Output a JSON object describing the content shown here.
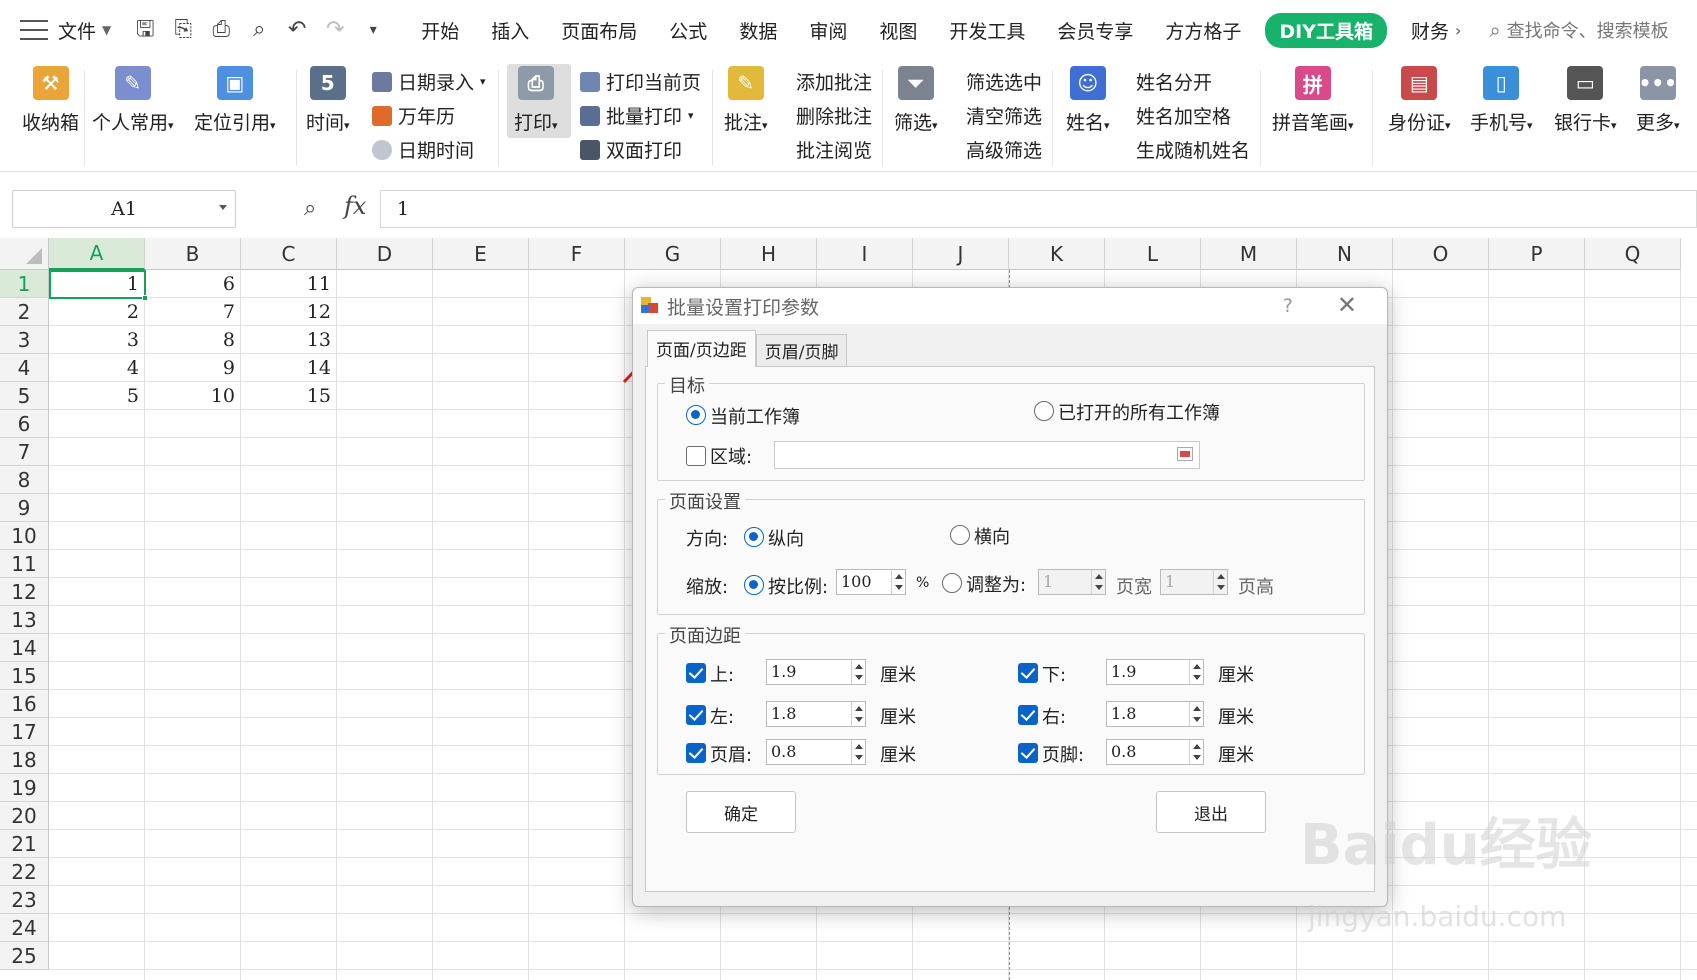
{
  "menubar": {
    "file_label": "文件",
    "tabs": [
      "开始",
      "插入",
      "页面布局",
      "公式",
      "数据",
      "审阅",
      "视图",
      "开发工具",
      "会员专享",
      "方方格子",
      "DIY工具箱",
      "财务"
    ],
    "search_placeholder": "查找命令、搜索模板"
  },
  "ribbon": {
    "toolbox": "收纳箱",
    "personal": "个人常用",
    "locate_ref": "定位引用",
    "time": "时间",
    "date_entry": "日期录入",
    "calendar": "万年历",
    "date_time": "日期时间",
    "print": "打印",
    "print_current": "打印当前页",
    "batch_print": "批量打印",
    "duplex_print": "双面打印",
    "comment": "批注",
    "add_comment": "添加批注",
    "delete_comment": "删除批注",
    "review_comment": "批注阅览",
    "filter": "筛选",
    "filter_selected": "筛选选中",
    "clear_filter": "清空筛选",
    "advanced_filter": "高级筛选",
    "name": "姓名",
    "split_name": "姓名分开",
    "name_spacing": "姓名加空格",
    "random_name": "生成随机姓名",
    "pinyin_strokes": "拼音笔画",
    "id_card": "身份证",
    "phone": "手机号",
    "bank_card": "银行卡",
    "more": "更多"
  },
  "formula_bar": {
    "name_box": "A1",
    "fx": "fx",
    "value": "1"
  },
  "sheet": {
    "columns": [
      "A",
      "B",
      "C",
      "D",
      "E",
      "F",
      "G",
      "H",
      "I",
      "J",
      "K",
      "L",
      "M",
      "N",
      "O",
      "P",
      "Q"
    ],
    "rows": [
      "1",
      "2",
      "3",
      "4",
      "5",
      "6",
      "7",
      "8",
      "9",
      "10",
      "11",
      "12",
      "13",
      "14",
      "15",
      "16",
      "17",
      "18",
      "19",
      "20",
      "21",
      "22",
      "23",
      "24",
      "25"
    ],
    "data": [
      [
        "1",
        "6",
        "11"
      ],
      [
        "2",
        "7",
        "12"
      ],
      [
        "3",
        "8",
        "13"
      ],
      [
        "4",
        "9",
        "14"
      ],
      [
        "5",
        "10",
        "15"
      ]
    ]
  },
  "dialog": {
    "title": "批量设置打印参数",
    "help": "?",
    "close": "✕",
    "tabs": [
      "页面/页边距",
      "页眉/页脚"
    ],
    "target": {
      "legend": "目标",
      "current_workbook": "当前工作簿",
      "all_open_workbooks": "已打开的所有工作簿",
      "range_label": "区域:",
      "range_value": ""
    },
    "page_setup": {
      "legend": "页面设置",
      "orientation_label": "方向:",
      "portrait": "纵向",
      "landscape": "横向",
      "scale_label": "缩放:",
      "by_ratio": "按比例:",
      "ratio_value": "100",
      "percent": "%",
      "fit_to": "调整为:",
      "fit_width_value": "1",
      "pages_wide": "页宽",
      "fit_height_value": "1",
      "pages_tall": "页高"
    },
    "margins": {
      "legend": "页面边距",
      "top_label": "上:",
      "top_value": "1.9",
      "bottom_label": "下:",
      "bottom_value": "1.9",
      "left_label": "左:",
      "left_value": "1.8",
      "right_label": "右:",
      "right_value": "1.8",
      "header_label": "页眉:",
      "header_value": "0.8",
      "footer_label": "页脚:",
      "footer_value": "0.8",
      "unit": "厘米"
    },
    "ok": "确定",
    "exit": "退出"
  },
  "watermark": {
    "brand": "Baidu经验",
    "url": "jingyan.baidu.com"
  },
  "colors": {
    "accent_green": "#18a058",
    "diy_tab": "#18b36a",
    "dialog_blue": "#0a64c8",
    "annotation_arrow": "#e02020"
  }
}
